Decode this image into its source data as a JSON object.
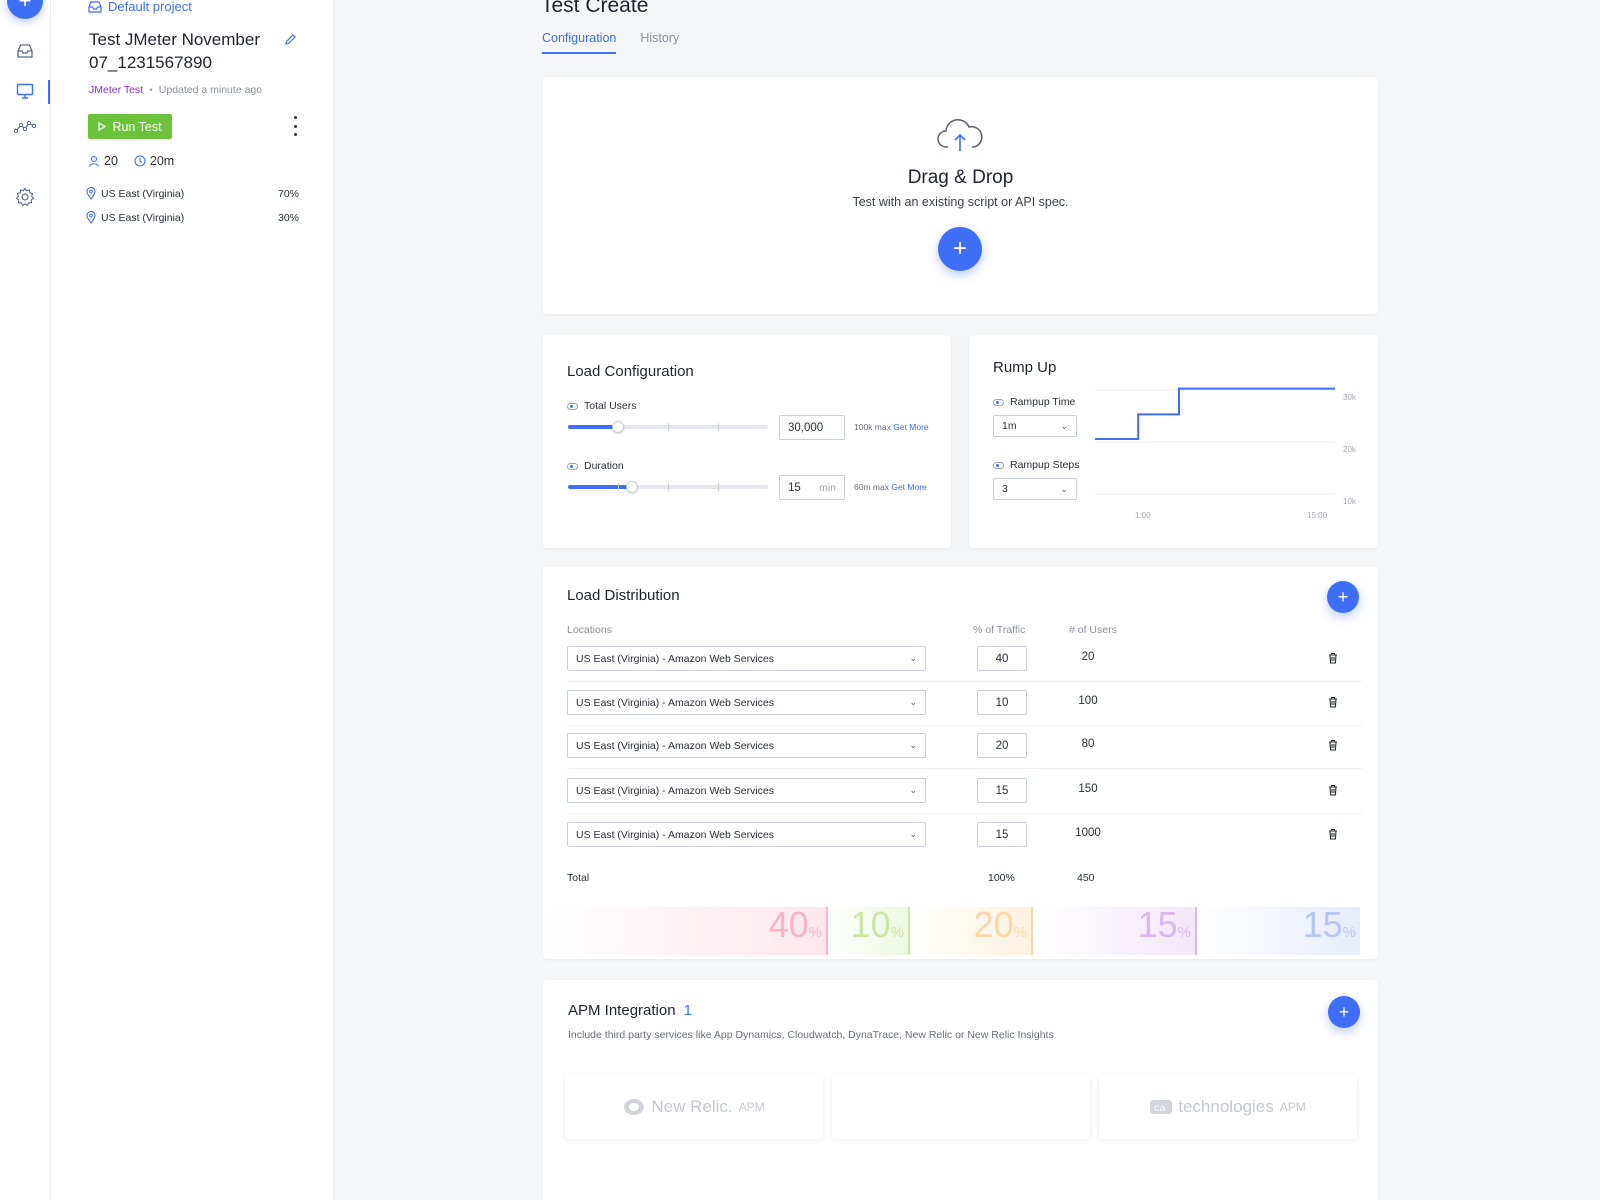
{
  "left_panel": {
    "project_label": "Default project",
    "test_title": "Test JMeter November 07_1231567890",
    "test_type": "JMeter Test",
    "meta_dot": "•",
    "updated": "Updated a minute ago",
    "run_button": "Run Test",
    "users_count": "20",
    "duration": "20m",
    "locations": [
      {
        "name": "US East (Virginia)",
        "percent": "70%"
      },
      {
        "name": "US East (Virginia)",
        "percent": "30%"
      }
    ]
  },
  "main": {
    "title": "Test Create",
    "tabs": [
      {
        "label": "Configuration",
        "active": true
      },
      {
        "label": "History",
        "active": false
      }
    ]
  },
  "drag_drop": {
    "title": "Drag & Drop",
    "subtitle": "Test with an existing script or API spec.",
    "add_button": "+"
  },
  "load_config": {
    "title": "Load Configuration",
    "total_users_label": "Total Users",
    "total_users_value": "30,000",
    "total_users_fraction": 0.25,
    "total_users_max": "100k max",
    "get_more": "Get More",
    "duration_label": "Duration",
    "duration_value": "15",
    "duration_unit": "min",
    "duration_fraction": 0.25,
    "duration_max": "60m max"
  },
  "ramp_up": {
    "title": "Rump Up",
    "rampup_time_label": "Rampup Time",
    "rampup_time_value": "1m",
    "rampup_steps_label": "Rampup Steps",
    "rampup_steps_value": "3",
    "chart_data": {
      "type": "line",
      "x_ticks": [
        "1:00",
        "15:00"
      ],
      "y_ticks": [
        "30k",
        "20k",
        "10k"
      ],
      "steps": [
        {
          "x_from": 0.0,
          "x_to": 0.18,
          "y": 0.5
        },
        {
          "x_from": 0.18,
          "x_to": 0.35,
          "y": 0.72
        },
        {
          "x_from": 0.35,
          "x_to": 1.0,
          "y": 0.95
        }
      ]
    }
  },
  "load_distribution": {
    "title": "Load Distribution",
    "col_locations": "Locations",
    "col_traffic": "% of Traffic",
    "col_users": "# of Users",
    "rows": [
      {
        "location": "US East (Virginia) - Amazon Web Services",
        "traffic": "40",
        "users": "20"
      },
      {
        "location": "US East (Virginia) - Amazon Web Services",
        "traffic": "10",
        "users": "100"
      },
      {
        "location": "US East (Virginia) - Amazon Web Services",
        "traffic": "20",
        "users": "80"
      },
      {
        "location": "US East (Virginia) - Amazon Web Services",
        "traffic": "15",
        "users": "150"
      },
      {
        "location": "US East (Virginia) - Amazon Web Services",
        "traffic": "15",
        "users": "1000"
      }
    ],
    "total_label": "Total",
    "total_traffic": "100%",
    "total_users": "450",
    "strip": [
      {
        "value": "40",
        "color": "#f7b6c8"
      },
      {
        "value": "10",
        "color": "#c9e6a3"
      },
      {
        "value": "20",
        "color": "#fbd7a6"
      },
      {
        "value": "15",
        "color": "#d9b8f0"
      },
      {
        "value": "15",
        "color": "#b6c6f5"
      }
    ],
    "percent_sign": "%"
  },
  "apm": {
    "title": "APM Integration",
    "count": "1",
    "subtitle": "Include third party services like App Dynamics, Cloudwatch, DynaTrace, New Relic or New Relic Insights",
    "providers": [
      {
        "name": "New Relic.",
        "suffix": "APM"
      },
      {
        "name": "",
        "suffix": ""
      },
      {
        "name": "technologies",
        "suffix": "APM"
      }
    ]
  },
  "colors": {
    "accent": "#3f6ef7",
    "run_green": "#6cc23a",
    "test_type_purple": "#8b2fd1"
  }
}
